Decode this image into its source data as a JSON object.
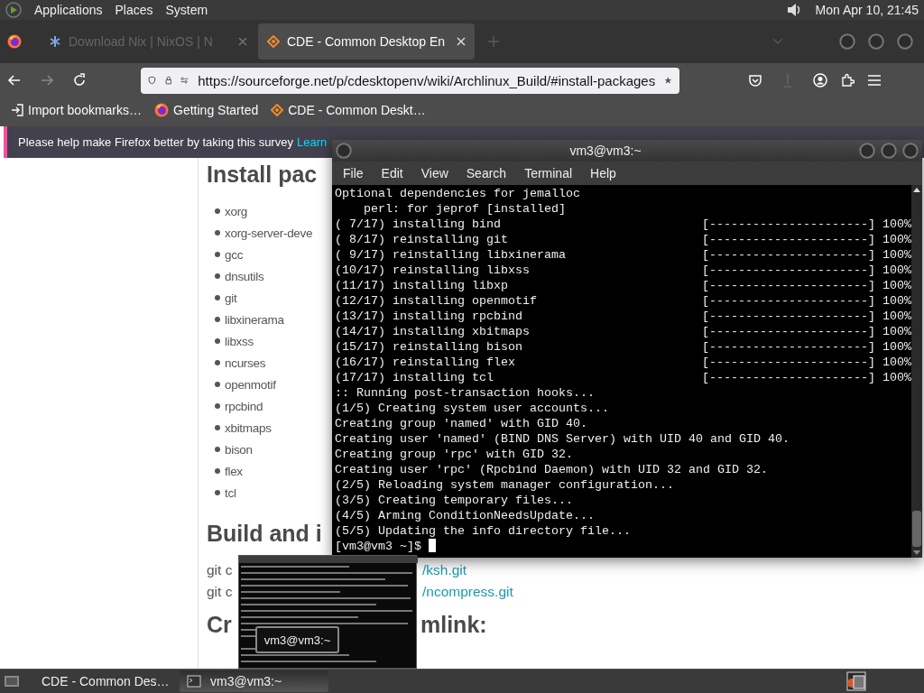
{
  "top_panel": {
    "menus": [
      "Applications",
      "Places",
      "System"
    ],
    "clock": "Mon Apr 10, 21:45"
  },
  "browser": {
    "tabs": [
      {
        "title": "Download Nix | NixOS | N",
        "selected": false
      },
      {
        "title": "CDE - Common Desktop En",
        "selected": true
      }
    ],
    "url": "https://sourceforge.net/p/cdesktopenv/wiki/Archlinux_Build/#install-packages",
    "bookmarks": [
      "Import bookmarks…",
      "Getting Started",
      "CDE - Common Deskt…"
    ],
    "notification": {
      "text": "Please help make Firefox better by taking this survey",
      "link": "Learn"
    },
    "page": {
      "heading_1": "Install pac",
      "packages": [
        "xorg",
        "xorg-server-deve",
        "gcc",
        "dnsutils",
        "git",
        "libxinerama",
        "libxss",
        "ncurses",
        "openmotif",
        "rpcbind",
        "xbitmaps",
        "bison",
        "flex",
        "tcl"
      ],
      "heading_2": "Build and i",
      "commands": [
        {
          "start": "git c",
          "end": "/ksh.git"
        },
        {
          "start": "git c",
          "end": "/ncompress.git"
        }
      ],
      "heading_3": {
        "start": "Cr",
        "end": "mlink:"
      }
    }
  },
  "terminal": {
    "title": "vm3@vm3:~",
    "menus": [
      "File",
      "Edit",
      "View",
      "Search",
      "Terminal",
      "Help"
    ],
    "lines": [
      {
        "text": "Optional dependencies for jemalloc"
      },
      {
        "text": "    perl: for jeprof [installed]"
      },
      {
        "text": "( 7/17) installing bind",
        "bar": "[----------------------]",
        "percent": "100%"
      },
      {
        "text": "( 8/17) reinstalling git",
        "bar": "[----------------------]",
        "percent": "100%"
      },
      {
        "text": "( 9/17) reinstalling libxinerama",
        "bar": "[----------------------]",
        "percent": "100%"
      },
      {
        "text": "(10/17) reinstalling libxss",
        "bar": "[----------------------]",
        "percent": "100%"
      },
      {
        "text": "(11/17) installing libxp",
        "bar": "[----------------------]",
        "percent": "100%"
      },
      {
        "text": "(12/17) installing openmotif",
        "bar": "[----------------------]",
        "percent": "100%"
      },
      {
        "text": "(13/17) installing rpcbind",
        "bar": "[----------------------]",
        "percent": "100%"
      },
      {
        "text": "(14/17) installing xbitmaps",
        "bar": "[----------------------]",
        "percent": "100%"
      },
      {
        "text": "(15/17) reinstalling bison",
        "bar": "[----------------------]",
        "percent": "100%"
      },
      {
        "text": "(16/17) reinstalling flex",
        "bar": "[----------------------]",
        "percent": "100%"
      },
      {
        "text": "(17/17) installing tcl",
        "bar": "[----------------------]",
        "percent": "100%"
      },
      {
        "text": ":: Running post-transaction hooks..."
      },
      {
        "text": "(1/5) Creating system user accounts..."
      },
      {
        "text": "Creating group 'named' with GID 40."
      },
      {
        "text": "Creating user 'named' (BIND DNS Server) with UID 40 and GID 40."
      },
      {
        "text": "Creating group 'rpc' with GID 32."
      },
      {
        "text": "Creating user 'rpc' (Rpcbind Daemon) with UID 32 and GID 32."
      },
      {
        "text": "(2/5) Reloading system manager configuration..."
      },
      {
        "text": "(3/5) Creating temporary files..."
      },
      {
        "text": "(4/5) Arming ConditionNeedsUpdate..."
      },
      {
        "text": "(5/5) Updating the info directory file..."
      }
    ],
    "prompt": "[vm3@vm3 ~]$"
  },
  "window_preview": {
    "label": "vm3@vm3:~"
  },
  "taskbar": {
    "tasks": [
      {
        "label": "CDE - Common Des…",
        "selected": false
      },
      {
        "label": "vm3@vm3:~",
        "selected": true
      }
    ]
  }
}
